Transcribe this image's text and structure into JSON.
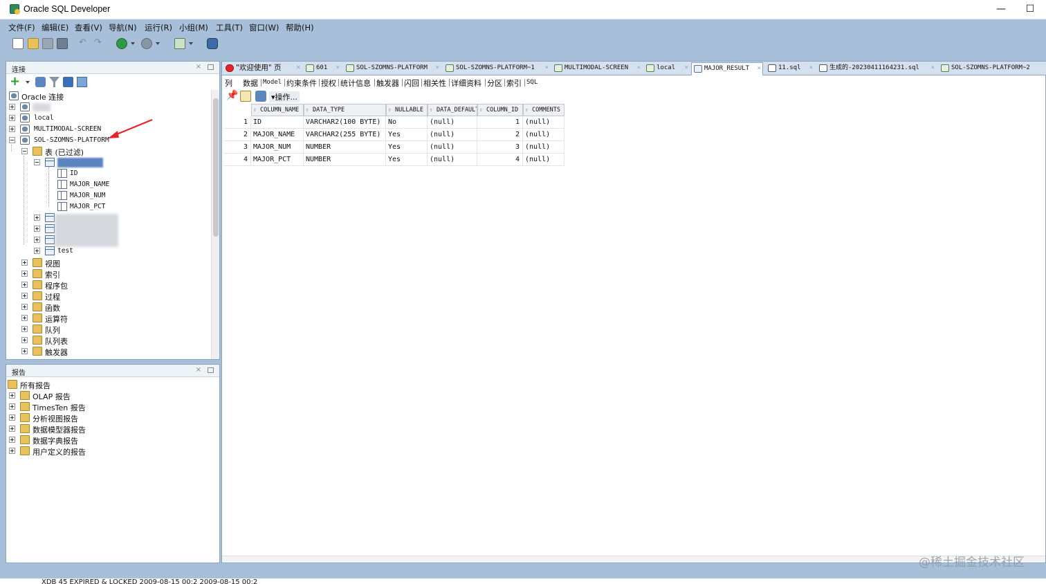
{
  "window": {
    "title": "Oracle SQL Developer",
    "minimize": "—",
    "maximize": "☐"
  },
  "menu": [
    "文件(F)",
    "编辑(E)",
    "查看(V)",
    "导航(N)",
    "运行(R)",
    "小组(M)",
    "工具(T)",
    "窗口(W)",
    "帮助(H)"
  ],
  "connections_panel": {
    "title": "连接",
    "close": "×",
    "tree": {
      "root": "Oracle 连接",
      "connections": [
        "local",
        "MULTIMODAL-SCREEN",
        "SOL-SZOMNS-PLATFORM"
      ],
      "tables_folder": "表 (已过滤)",
      "columns": [
        "ID",
        "MAJOR_NAME",
        "MAJOR_NUM",
        "MAJOR_PCT"
      ],
      "other_table": "test",
      "folders": [
        "视图",
        "索引",
        "程序包",
        "过程",
        "函数",
        "运算符",
        "队列",
        "队列表",
        "触发器"
      ]
    }
  },
  "reports_panel": {
    "title": "报告",
    "close": "×",
    "items": [
      "所有报告",
      "OLAP 报告",
      "TimesTen 报告",
      "分析视图报告",
      "数据模型器报告",
      "数据字典报告",
      "用户定义的报告"
    ]
  },
  "editor": {
    "tabs": [
      "\"欢迎使用\" 页",
      "601",
      "SOL-SZOMNS-PLATFORM",
      "SOL-SZOMNS-PLATFORM~1",
      "MULTIMODAL-SCREEN",
      "local",
      "MAJOR_RESULT",
      "11.sql",
      "生成的-20230411164231.sql",
      "SOL-SZOMNS-PLATFORM~2"
    ],
    "active_tab": "MAJOR_RESULT",
    "subtabs": [
      "列",
      "数据",
      "Model",
      "约束条件",
      "授权",
      "统计信息",
      "触发器",
      "闪回",
      "相关性",
      "详细资料",
      "分区",
      "索引",
      "SQL"
    ],
    "actions_label": "▾操作...",
    "grid": {
      "headers": [
        "COLUMN_NAME",
        "DATA_TYPE",
        "NULLABLE",
        "DATA_DEFAULT",
        "COLUMN_ID",
        "COMMENTS"
      ],
      "rows": [
        {
          "n": "1",
          "column_name": "ID",
          "data_type": "VARCHAR2(100 BYTE)",
          "nullable": "No",
          "data_default": "(null)",
          "column_id": "1",
          "comments": "(null)"
        },
        {
          "n": "2",
          "column_name": "MAJOR_NAME",
          "data_type": "VARCHAR2(255 BYTE)",
          "nullable": "Yes",
          "data_default": "(null)",
          "column_id": "2",
          "comments": "(null)"
        },
        {
          "n": "3",
          "column_name": "MAJOR_NUM",
          "data_type": "NUMBER",
          "nullable": "Yes",
          "data_default": "(null)",
          "column_id": "3",
          "comments": "(null)"
        },
        {
          "n": "4",
          "column_name": "MAJOR_PCT",
          "data_type": "NUMBER",
          "nullable": "Yes",
          "data_default": "(null)",
          "column_id": "4",
          "comments": "(null)"
        }
      ]
    }
  },
  "watermark": "@稀土掘金技术社区",
  "status_line": "XDB          45   EXPIRED & LOCKED          2009-08-15 00:2   2009-08-15 00:2",
  "colors": {
    "frame": "#a7bfd8",
    "accent_red": "#e8222b",
    "selection": "#3f6fb5"
  }
}
